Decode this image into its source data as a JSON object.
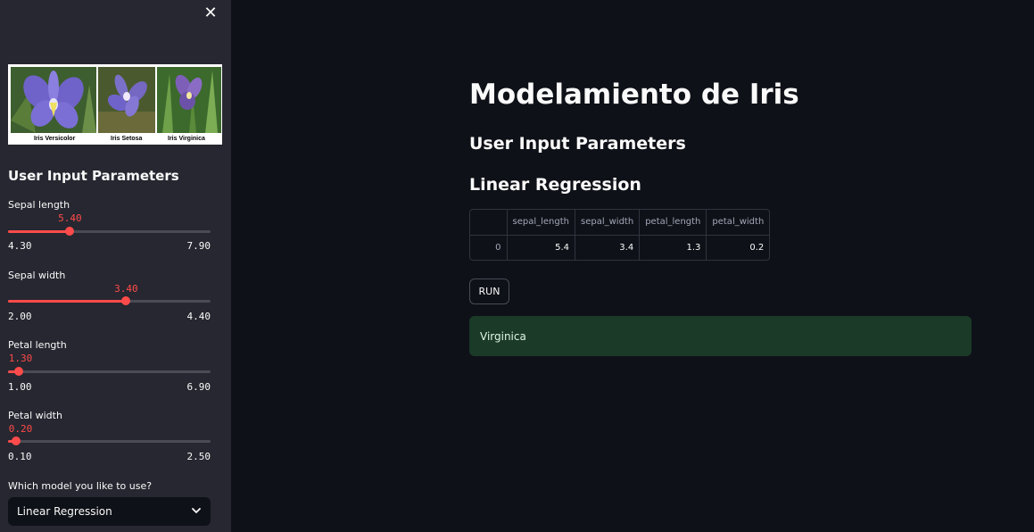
{
  "sidebar": {
    "close_icon": "close-icon",
    "banner": {
      "captions": [
        "Iris Versicolor",
        "Iris Setosa",
        "Iris Virginica"
      ]
    },
    "heading": "User Input Parameters",
    "sliders": [
      {
        "label": "Sepal length",
        "value": "5.40",
        "min": "4.30",
        "max": "7.90",
        "fraction": 0.3056
      },
      {
        "label": "Sepal width",
        "value": "3.40",
        "min": "2.00",
        "max": "4.40",
        "fraction": 0.5833
      },
      {
        "label": "Petal length",
        "value": "1.30",
        "min": "1.00",
        "max": "6.90",
        "fraction": 0.0508
      },
      {
        "label": "Petal width",
        "value": "0.20",
        "min": "0.10",
        "max": "2.50",
        "fraction": 0.0417
      }
    ],
    "model_select": {
      "label": "Which model you like to use?",
      "value": "Linear Regression",
      "icon": "chevron-down-icon"
    }
  },
  "main": {
    "title": "Modelamiento de Iris",
    "subheader": "User Input Parameters",
    "model_header": "Linear Regression",
    "table": {
      "columns": [
        "",
        "sepal_length",
        "sepal_width",
        "petal_length",
        "petal_width"
      ],
      "rows": [
        [
          "0",
          "5.4",
          "3.4",
          "1.3",
          "0.2"
        ]
      ]
    },
    "run_button": "RUN",
    "result": "Virginica"
  },
  "colors": {
    "accent": "#ff4b4b",
    "background": "#0e1117",
    "sidebar": "#262730",
    "success_bg": "#1b3a28"
  }
}
